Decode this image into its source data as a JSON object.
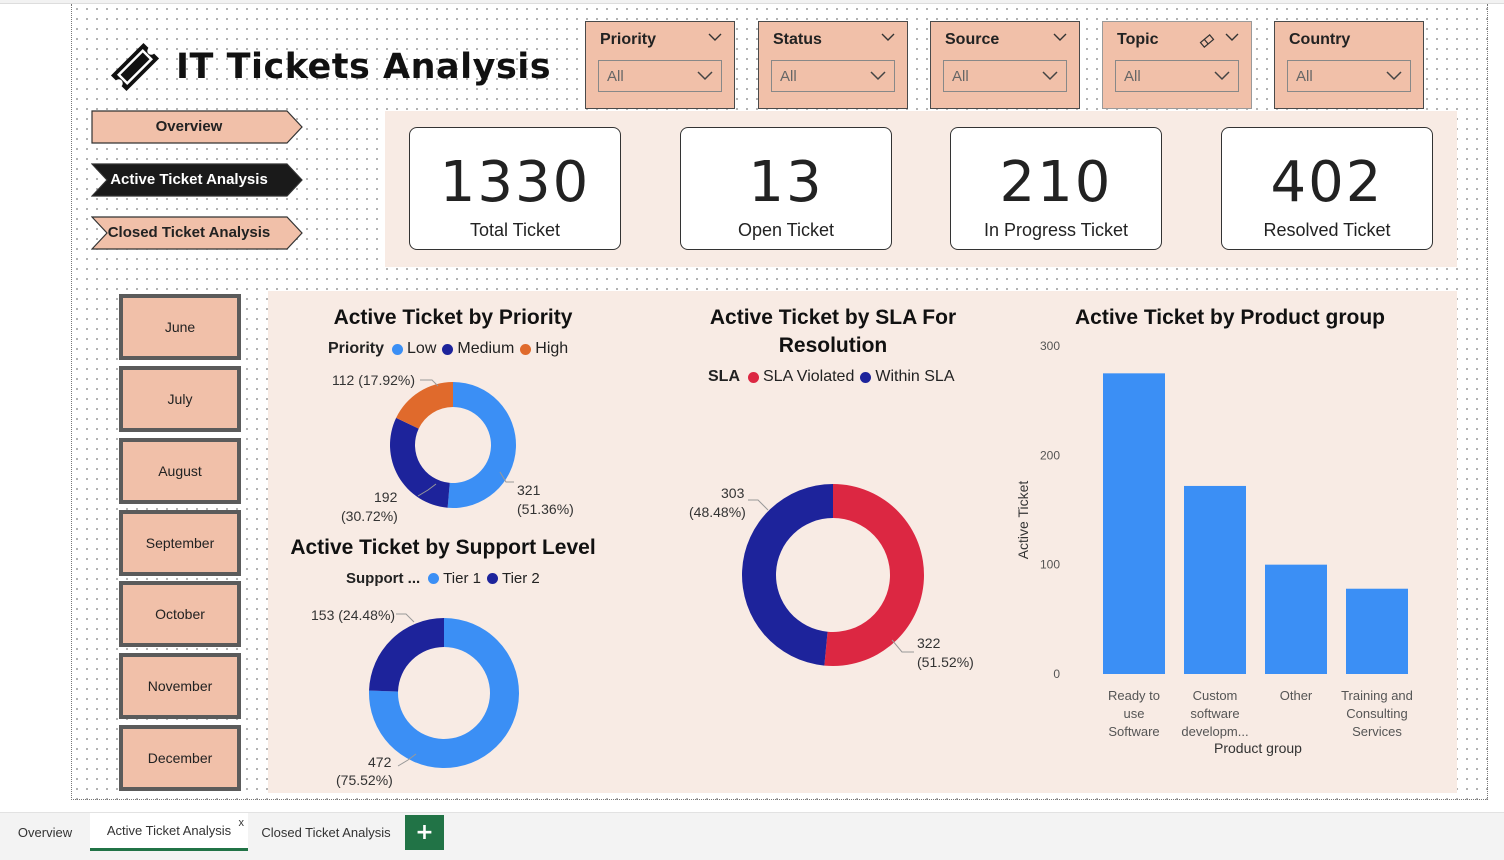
{
  "report": {
    "title": "IT Tickets Analysis"
  },
  "filters": [
    {
      "label": "Priority",
      "value": "All"
    },
    {
      "label": "Status",
      "value": "All"
    },
    {
      "label": "Source",
      "value": "All"
    },
    {
      "label": "Topic",
      "value": "All"
    },
    {
      "label": "Country",
      "value": "All"
    }
  ],
  "nav": {
    "overview": "Overview",
    "active": "Active Ticket Analysis",
    "closed": "Closed Ticket Analysis"
  },
  "kpis": [
    {
      "value": "1330",
      "label": "Total Ticket"
    },
    {
      "value": "13",
      "label": "Open Ticket"
    },
    {
      "value": "210",
      "label": "In Progress Ticket"
    },
    {
      "value": "402",
      "label": "Resolved Ticket"
    }
  ],
  "months": [
    "June",
    "July",
    "August",
    "September",
    "October",
    "November",
    "December"
  ],
  "colors": {
    "accent_fill": "#f1c0a9",
    "panel_bg": "#f8ebe4",
    "light_blue": "#3b8ff5",
    "dark_blue": "#1d239b",
    "orange": "#e06a2c",
    "red": "#dc2742",
    "tab_green": "#217346"
  },
  "charts": {
    "priority": {
      "title": "Active Ticket by Priority",
      "legend_title": "Priority",
      "legend": [
        "Low",
        "Medium",
        "High"
      ],
      "label_high": "112 (17.92%)",
      "label_medium_1": "192",
      "label_medium_2": "(30.72%)",
      "label_low_1": "321",
      "label_low_2": "(51.36%)"
    },
    "support": {
      "title": "Active Ticket by Support Level",
      "legend_title": "Support ...",
      "legend": [
        "Tier 1",
        "Tier 2"
      ],
      "label_tier2": "153 (24.48%)",
      "label_tier1_1": "472",
      "label_tier1_2": "(75.52%)"
    },
    "sla": {
      "title_1": "Active Ticket by SLA For",
      "title_2": "Resolution",
      "legend_title": "SLA",
      "legend": [
        "SLA Violated",
        "Within SLA"
      ],
      "label_within_1": "303",
      "label_within_2": "(48.48%)",
      "label_violated_1": "322",
      "label_violated_2": "(51.52%)"
    },
    "product": {
      "title": "Active Ticket by Product group"
    }
  },
  "chart_data": [
    {
      "type": "pie",
      "title": "Active Ticket by Priority",
      "legend_title": "Priority",
      "categories": [
        "Low",
        "Medium",
        "High"
      ],
      "values": [
        321,
        192,
        112
      ],
      "percents": [
        51.36,
        30.72,
        17.92
      ],
      "colors": [
        "#3b8ff5",
        "#1d239b",
        "#e06a2c"
      ]
    },
    {
      "type": "pie",
      "title": "Active Ticket by Support Level",
      "legend_title": "Support ...",
      "categories": [
        "Tier 1",
        "Tier 2"
      ],
      "values": [
        472,
        153
      ],
      "percents": [
        75.52,
        24.48
      ],
      "colors": [
        "#3b8ff5",
        "#1d239b"
      ]
    },
    {
      "type": "pie",
      "title": "Active Ticket by SLA For Resolution",
      "legend_title": "SLA",
      "categories": [
        "SLA Violated",
        "Within SLA"
      ],
      "values": [
        322,
        303
      ],
      "percents": [
        51.52,
        48.48
      ],
      "colors": [
        "#dc2742",
        "#1d239b"
      ]
    },
    {
      "type": "bar",
      "title": "Active Ticket by Product group",
      "categories": [
        [
          "Ready to",
          "use",
          "Software"
        ],
        [
          "Custom",
          "software",
          "developm..."
        ],
        [
          "Other"
        ],
        [
          "Training and",
          "Consulting",
          "Services"
        ]
      ],
      "values": [
        275,
        172,
        100,
        78
      ],
      "xlabel": "Product group",
      "ylabel": "Active Ticket",
      "yticks": [
        0,
        100,
        200,
        300
      ],
      "ylim": [
        0,
        300
      ],
      "grid": false,
      "color": "#3b8ff5"
    }
  ],
  "tabs": {
    "overview": "Overview",
    "active": "Active Ticket Analysis",
    "closed": "Closed Ticket Analysis",
    "close_glyph": "x",
    "add_glyph": "+"
  }
}
